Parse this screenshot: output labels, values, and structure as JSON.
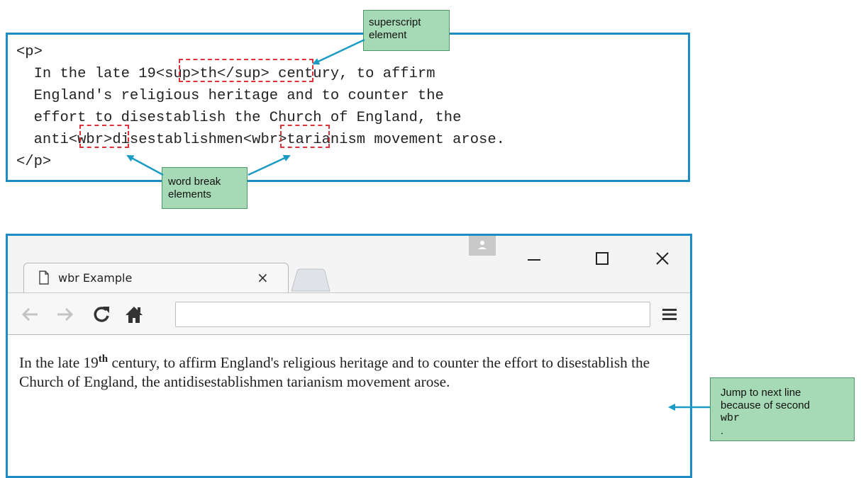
{
  "code_panel": {
    "line1": "<p>",
    "line2_a": "  In the late 19",
    "line2_sup": "<sup>th</sup>",
    "line2_b": " century, to affirm",
    "line3": "  England's religious heritage and to counter the",
    "line4": "  effort to disestablish the Church of England, the",
    "line5_a": "  anti",
    "line5_wbr1": "<wbr>",
    "line5_b": "disestablishmen",
    "line5_wbr2": "<wbr>",
    "line5_c": "tarianism movement arose.",
    "line6": "</p>"
  },
  "callouts": {
    "superscript": [
      "superscript",
      "element"
    ],
    "word_break": [
      "word break",
      "elements"
    ],
    "jump": {
      "line1": "Jump to next line",
      "line2": "because of second",
      "code": "wbr",
      "period": "."
    }
  },
  "browser": {
    "tab_title": "wbr Example",
    "tab_close": "×",
    "page_text_before_sup": "In the late 19",
    "page_sup": "th",
    "page_text_after_sup": " century, to affirm England's religious heritage and to counter the effort to disestablish the Church of England, the antidisestablishmen tarianism movement arose.",
    "icons": [
      "profile-icon",
      "minimize-icon",
      "maximize-icon",
      "close-icon",
      "page-icon",
      "back-icon",
      "forward-icon",
      "reload-icon",
      "home-icon",
      "menu-icon"
    ]
  },
  "colors": {
    "frame_blue": "#1d8bc4",
    "callout_green": "#a6d9b5",
    "dash_red": "#e0303a",
    "arrow_teal": "#1c9bc4"
  }
}
